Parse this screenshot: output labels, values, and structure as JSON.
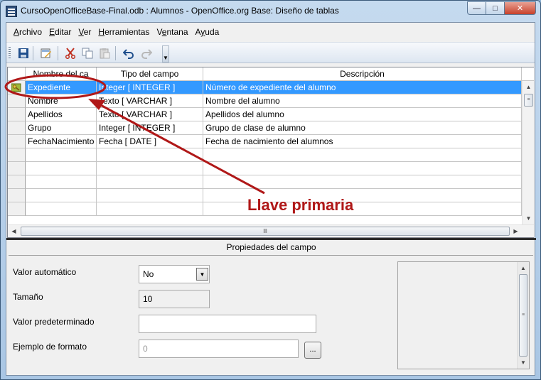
{
  "window": {
    "title": "CursoOpenOfficeBase-Final.odb : Alumnos - OpenOffice.org Base: Diseño de tablas",
    "controls": {
      "minimize": "—",
      "maximize": "□",
      "close": "✕"
    }
  },
  "menu": [
    "Archivo",
    "Editar",
    "Ver",
    "Herramientas",
    "Ventana",
    "Ayuda"
  ],
  "toolbar": {
    "icons": [
      "save-icon",
      "edit-icon",
      "cut-icon",
      "copy-icon",
      "paste-icon",
      "undo-icon",
      "redo-icon"
    ]
  },
  "table": {
    "headers": [
      "Nombre del ca",
      "Tipo del campo",
      "Descripción"
    ],
    "rows": [
      {
        "name": "Expediente",
        "type": "Integer [ INTEGER ]",
        "desc": "Número de expediente del alumno",
        "primary_key": true
      },
      {
        "name": "Nombre",
        "type": "Texto [ VARCHAR ]",
        "desc": "Nombre del alumno"
      },
      {
        "name": "Apellidos",
        "type": "Texto [ VARCHAR ]",
        "desc": "Apellidos del alumno"
      },
      {
        "name": "Grupo",
        "type": "Integer [ INTEGER ]",
        "desc": "Grupo de clase de alumno"
      },
      {
        "name": "FechaNacimiento",
        "type": "Fecha [ DATE ]",
        "desc": "Fecha de nacimiento del alumnos"
      }
    ],
    "hscroll_grip": "lll"
  },
  "properties": {
    "title": "Propiedades del campo",
    "auto_value": {
      "label": "Valor automático",
      "value": "No"
    },
    "size": {
      "label": "Tamaño",
      "value": "10"
    },
    "default_value": {
      "label": "Valor predeterminado",
      "value": ""
    },
    "format_example": {
      "label": "Ejemplo de formato",
      "value": "0",
      "button": "..."
    }
  },
  "annotation": {
    "label": "Llave primaria",
    "color": "#b01818"
  }
}
